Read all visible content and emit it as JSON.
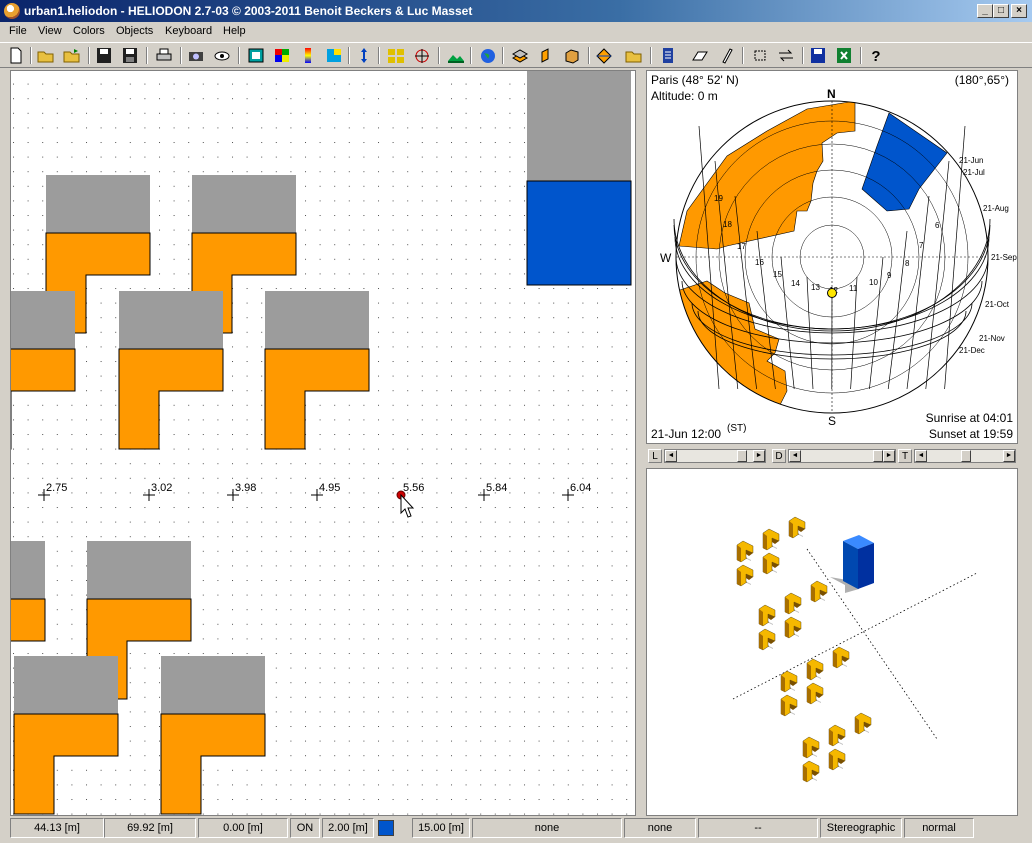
{
  "window": {
    "title": "urban1.heliodon  -  HELIODON 2.7-03 © 2003-2011 Benoit Beckers & Luc Masset",
    "buttons": {
      "minimize": "_",
      "maximize": "□",
      "close": "×"
    }
  },
  "menu": [
    "File",
    "View",
    "Colors",
    "Objects",
    "Keyboard",
    "Help"
  ],
  "toolbar": [
    "new-file-icon",
    "open-folder-icon",
    "open-folder-2-icon",
    "save-icon",
    "save-as-icon",
    "print-icon",
    "camera-icon",
    "eye-icon",
    "frame-icon",
    "grid-colors-icon",
    "color-scale-icon",
    "tiles-icon",
    "vertical-arrows-icon",
    "layout-icon",
    "compass-rose-icon",
    "landscape-icon",
    "globe-icon",
    "layers-icon",
    "surface-icon",
    "box-icon",
    "diamond-icon",
    "folder-export-icon",
    "list-icon",
    "plane-icon",
    "pencil-icon",
    "fit-icon",
    "swap-icon",
    "save-disk-icon",
    "excel-icon",
    "help-icon"
  ],
  "colors": {
    "building_roof": "#9c9c9c",
    "building_shadow": "#ff9900",
    "building_selected": "#0055cc",
    "sun": "#ffe600",
    "probe": "#cc0000"
  },
  "plan": {
    "labels": [
      "2.75",
      "3.02",
      "3.98",
      "4.95",
      "5.56",
      "5.84",
      "6.04"
    ]
  },
  "sunchart": {
    "location": "Paris (48° 52' N)",
    "altitude": "Altitude: 0 m",
    "view_angles": "(180°,65°)",
    "north": "N",
    "south": "S",
    "west": "W",
    "date_time": "21-Jun 12:00",
    "time_ref": "(ST)",
    "sunrise": "Sunrise at 04:01",
    "sunset": "Sunset at 19:59",
    "months": [
      "21-Jun",
      "21-Jul",
      "21-Aug",
      "21-Sep",
      "21-Oct",
      "21-Nov",
      "21-Dec"
    ],
    "hours": [
      "19",
      "18",
      "17",
      "16",
      "15",
      "14",
      "13",
      "12",
      "11",
      "10",
      "9",
      "8",
      "7",
      "6"
    ]
  },
  "sliders": {
    "l": "L",
    "d": "D",
    "t": "T"
  },
  "status": {
    "x": "44.13 [m]",
    "y": "69.92 [m]",
    "z": "0.00 [m]",
    "grid": "ON",
    "step": "2.00 [m]",
    "height": "15.00 [m]",
    "s1": "none",
    "s2": "none",
    "s3": "--",
    "projection": "Stereographic",
    "mode": "normal"
  }
}
